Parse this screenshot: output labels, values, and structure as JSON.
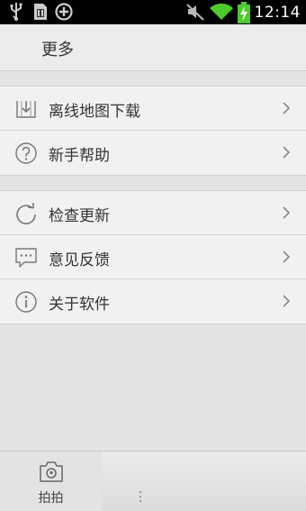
{
  "status_bar": {
    "time": "12:14",
    "icons": [
      "usb-icon",
      "sd-card-icon",
      "add-circle-icon",
      "mute-icon",
      "wifi-icon",
      "battery-charging-icon"
    ]
  },
  "header": {
    "title": "更多"
  },
  "menu": {
    "group1": [
      {
        "label": "离线地图下载",
        "icon": "download-map-icon"
      },
      {
        "label": "新手帮助",
        "icon": "help-icon"
      }
    ],
    "group2": [
      {
        "label": "检查更新",
        "icon": "refresh-icon"
      },
      {
        "label": "意见反馈",
        "icon": "feedback-icon"
      },
      {
        "label": "关于软件",
        "icon": "info-icon"
      }
    ]
  },
  "tabbar": {
    "tabs": [
      {
        "label": "拍拍",
        "icon": "camera-icon"
      }
    ]
  },
  "colors": {
    "background": "#e4e4e4",
    "row_bg": "#f1f1f1",
    "status_bar": "#000000",
    "battery": "#4ccb2a"
  }
}
